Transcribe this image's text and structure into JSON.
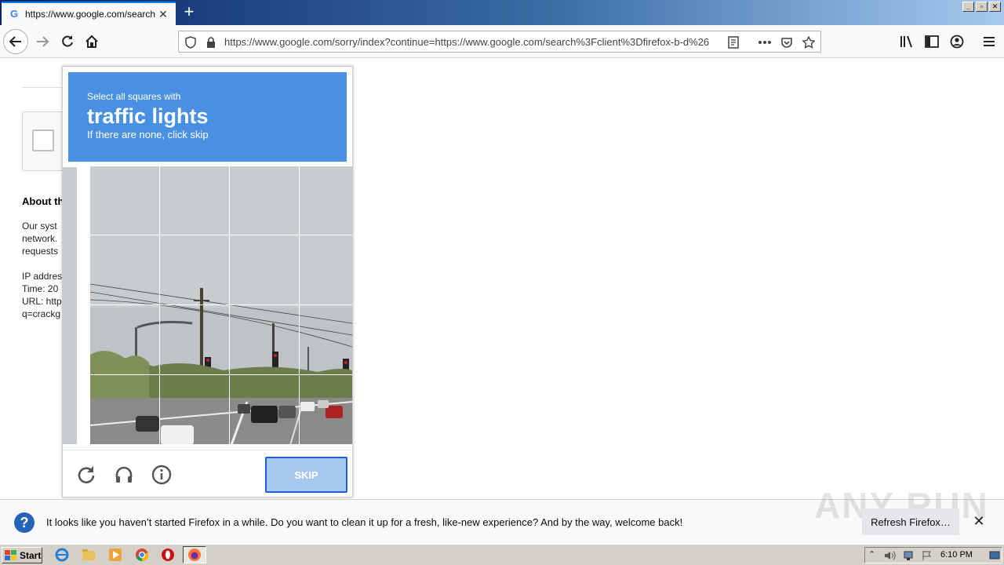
{
  "browser": {
    "tab_title": "https://www.google.com/search?c",
    "tab_favicon": "G",
    "new_tab": "+",
    "close_tab": "✕",
    "url": "https://www.google.com/sorry/index?continue=https://www.google.com/search%3Fclient%3Dfirefox-b-d%26",
    "window_buttons": [
      "_",
      "▫",
      "✕"
    ]
  },
  "page": {
    "about_heading": "About th",
    "about_lines": [
      "Our syst",
      "network.",
      "requests"
    ],
    "info_lines": [
      "IP addres",
      "Time: 20",
      "URL: http",
      "q=crackg"
    ]
  },
  "challenge": {
    "instruction_small": "Select all squares with",
    "instruction_target": "traffic lights",
    "instruction_hint": "If there are none, click skip",
    "skip_label": "SKIP",
    "footer_icons": [
      "reload-icon",
      "audio-icon",
      "info-icon"
    ]
  },
  "notification": {
    "text": "It looks like you haven’t started Firefox in a while. Do you want to clean it up for a fresh, like-new experience? And by the way, welcome back!",
    "button_label": "Refresh Firefox…",
    "close": "✕",
    "watermark": "ANY RUN"
  },
  "taskbar": {
    "start_label": "Start",
    "clock": "6:10 PM"
  },
  "colors": {
    "challenge_blue": "#4a90e2",
    "skip_bg": "#a6c8f0",
    "titlebar_start": "#0a246a",
    "titlebar_end": "#a6caf0"
  }
}
